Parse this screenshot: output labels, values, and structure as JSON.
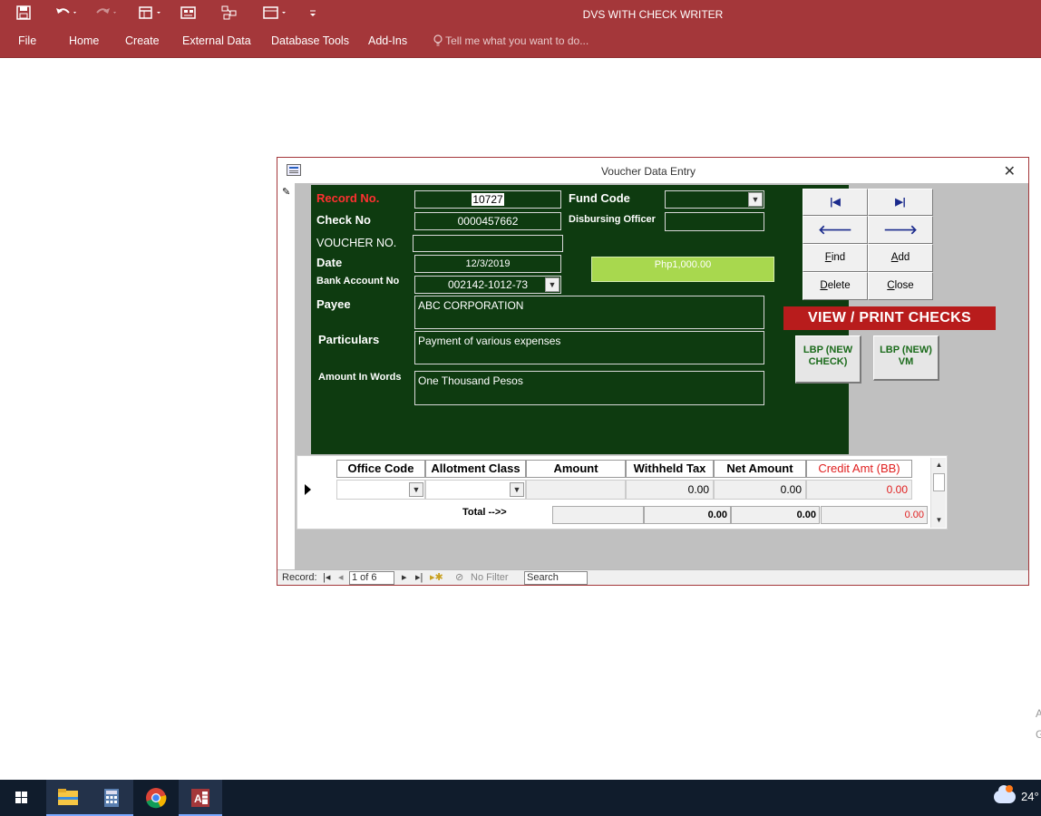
{
  "app": {
    "title": "DVS WITH CHECK WRITER",
    "colors": {
      "ribbon": "#a4373a",
      "form_panel": "#0e3b10",
      "view_print": "#b81c1c"
    }
  },
  "menu": {
    "file": "File",
    "home": "Home",
    "create": "Create",
    "external_data": "External Data",
    "database_tools": "Database Tools",
    "add_ins": "Add-Ins",
    "tell_me": "Tell me what you want to do..."
  },
  "form": {
    "title": "Voucher Data Entry",
    "close": "✕",
    "labels": {
      "record_no": "Record No.",
      "check_no": "Check No",
      "voucher_no": "VOUCHER NO.",
      "date": "Date",
      "bank_account_no": "Bank Account No",
      "payee": "Payee",
      "particulars": "Particulars",
      "amount_in_words": "Amount In Words",
      "fund_code": "Fund Code",
      "disbursing_officer": "Disbursing Officer"
    },
    "values": {
      "record_no": "10727",
      "check_no": "0000457662",
      "voucher_no": "",
      "date": "12/3/2019",
      "bank_account_no": "002142-1012-73",
      "payee": "ABC CORPORATION",
      "particulars": "Payment of various expenses",
      "amount_in_words": "One Thousand  Pesos",
      "fund_code": "",
      "disbursing_officer": "",
      "amount": "Php1,000.00"
    },
    "buttons": {
      "first": "|◀",
      "last": "▶|",
      "prev": "🡐",
      "next": "🡒",
      "find_u": "F",
      "find_rest": "ind",
      "add_u": "A",
      "add_rest": "dd",
      "delete_u": "D",
      "delete_rest": "elete",
      "close_u": "C",
      "close_rest": "lose",
      "view_print": "VIEW / PRINT CHECKS",
      "lbp_new_check": "LBP (NEW CHECK)",
      "lbp_new_vm": "LBP (NEW) VM"
    }
  },
  "subform": {
    "columns": [
      "Office Code",
      "Allotment Class",
      "Amount",
      "Withheld Tax",
      "Net Amount",
      "Credit Amt (BB)"
    ],
    "row": {
      "office_code": "",
      "allotment_class": "",
      "amount": "",
      "withheld_tax": "0.00",
      "net_amount": "0.00",
      "credit_amt": "0.00"
    },
    "total_label": "Total -->>",
    "totals": {
      "amount": "",
      "withheld_tax": "0.00",
      "net_amount": "0.00",
      "credit_amt": "0.00"
    }
  },
  "navbar": {
    "record_label": "Record:",
    "position": "1 of 6",
    "no_filter": "No Filter",
    "search": "Search"
  },
  "taskbar": {
    "temperature": "24°",
    "apps": [
      "windows-start",
      "file-explorer",
      "calculator",
      "chrome",
      "access"
    ]
  }
}
